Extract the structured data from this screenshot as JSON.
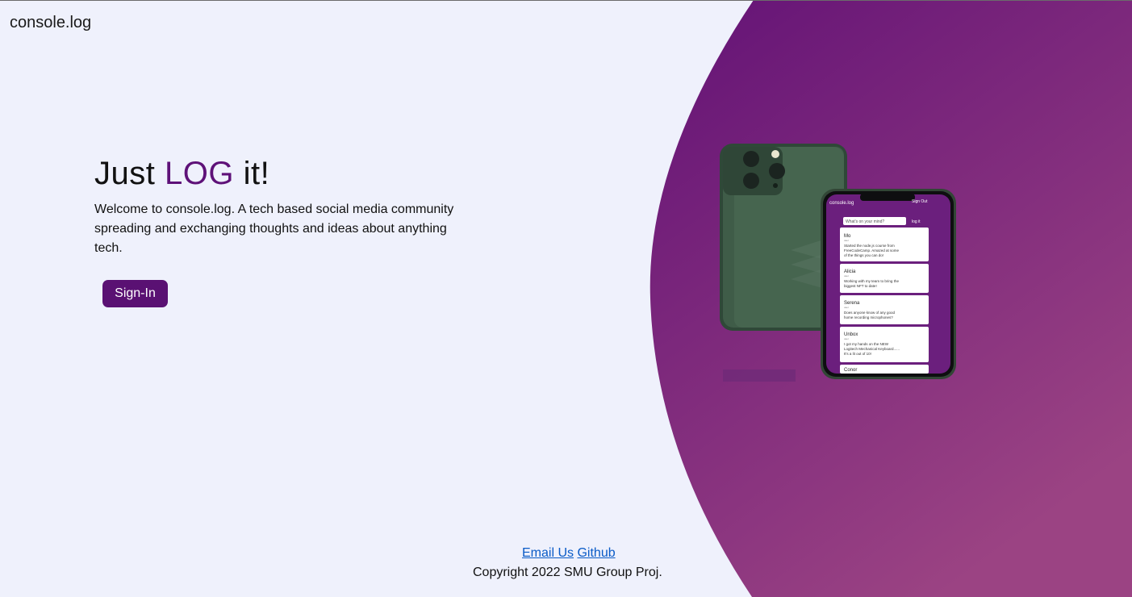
{
  "header": {
    "brand": "console.log"
  },
  "hero": {
    "title_prefix": "Just ",
    "title_accent": "LOG",
    "title_suffix": " it!",
    "description": "Welcome to console.log. A tech based social media community spreading and exchanging thoughts and ideas about anything tech.",
    "signin_label": "Sign-In"
  },
  "mockup": {
    "app_name": "console.log",
    "signout_label": "Sign Out",
    "input_placeholder": "What's on your mind?",
    "log_button": "log it",
    "posts": [
      {
        "name": "Mo",
        "role": "user",
        "text_l1": "Started the node.js course from",
        "text_l2": "FreeCodeCamp. Amazed at some",
        "text_l3": "of the things you can do!"
      },
      {
        "name": "Alicia",
        "role": "user",
        "text_l1": "Working with my team to bring the",
        "text_l2": "biggest NFT to date!",
        "text_l3": ""
      },
      {
        "name": "Serena",
        "role": "user",
        "text_l1": "Does anyone know of any good",
        "text_l2": "home recording microphones?",
        "text_l3": ""
      },
      {
        "name": "Unbox",
        "role": "user",
        "text_l1": "I got my hands on the NEW",
        "text_l2": "Logitech Mechanical Keyboard......",
        "text_l3": "It's a lit out of 10!"
      },
      {
        "name": "Conor",
        "role": "",
        "text_l1": "",
        "text_l2": "",
        "text_l3": ""
      }
    ]
  },
  "footer": {
    "email_label": "Email Us",
    "github_label": "Github",
    "copyright": "Copyright 2022 SMU Group Proj."
  },
  "colors": {
    "accent": "#5e1178",
    "background": "#eff1fc",
    "gradient_top": "#5e1378",
    "gradient_bottom": "#9a4284",
    "link": "#0a5bc7"
  }
}
